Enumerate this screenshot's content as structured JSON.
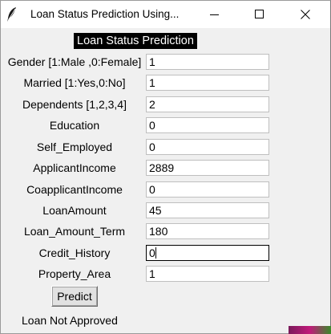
{
  "window": {
    "title": "Loan Status Prediction Using..."
  },
  "form": {
    "heading": "Loan Status Prediction",
    "fields": [
      {
        "label": "Gender [1:Male ,0:Female]",
        "value": "1"
      },
      {
        "label": "Married [1:Yes,0:No]",
        "value": "1"
      },
      {
        "label": "Dependents [1,2,3,4]",
        "value": "2"
      },
      {
        "label": "Education",
        "value": "0"
      },
      {
        "label": "Self_Employed",
        "value": "0"
      },
      {
        "label": "ApplicantIncome",
        "value": "2889"
      },
      {
        "label": "CoapplicantIncome",
        "value": "0"
      },
      {
        "label": "LoanAmount",
        "value": "45"
      },
      {
        "label": "Loan_Amount_Term",
        "value": "180"
      },
      {
        "label": "Credit_History",
        "value": "0"
      },
      {
        "label": "Property_Area",
        "value": "1"
      }
    ],
    "predict_label": "Predict",
    "result": "Loan Not Approved"
  },
  "icons": {
    "app": "feather-icon",
    "minimize": "minimize-icon",
    "maximize": "maximize-icon",
    "close": "close-icon"
  },
  "colors": {
    "heading_bg": "#000000",
    "heading_fg": "#ffffff",
    "window_bg": "#f0f0f0"
  }
}
